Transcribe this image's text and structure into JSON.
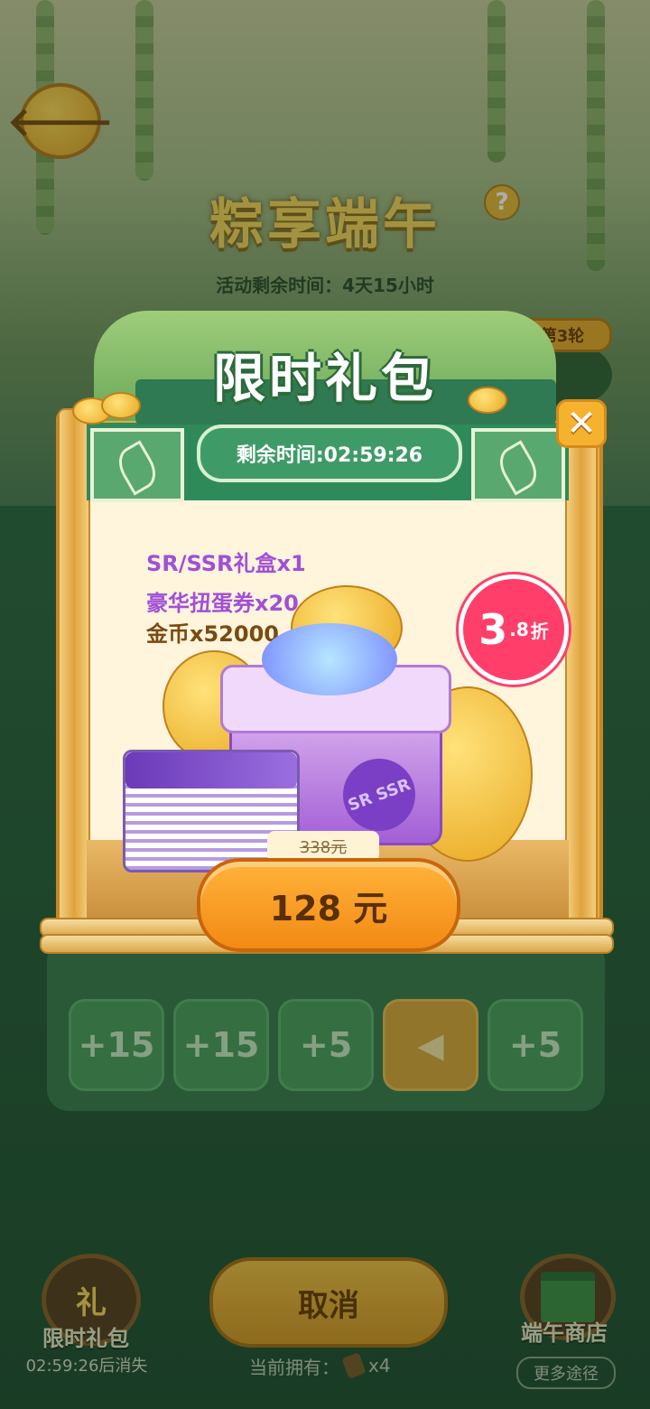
{
  "event": {
    "title": "粽享端午",
    "help_glyph": "?",
    "remaining": "活动剩余时间：4天15小时",
    "round": "第3轮",
    "back_glyph": "🡐"
  },
  "grid": {
    "tiles": [
      "+15",
      "+15",
      "+5",
      "◀",
      "+5"
    ]
  },
  "popup": {
    "title": "限时礼包",
    "close_glyph": "✕",
    "timer": "剩余时间:02:59:26",
    "items": [
      "SR/SSR礼盒x1",
      "豪华扭蛋券x20",
      "金币x52000"
    ],
    "discount_big": "3",
    "discount_small": ".8",
    "discount_unit": "折",
    "gift_logo": "SR SSR",
    "old_price": "338元",
    "buy_label": "128 元"
  },
  "bottom": {
    "left_label": "限时礼包",
    "left_icon": "礼",
    "left_timer": "02:59:26后消失",
    "cancel_label": "取消",
    "owned_label": "当前拥有：",
    "owned_count": "x4",
    "shop_label": "端午商店",
    "more_label": "更多途径"
  },
  "colors": {
    "accent_orange": "#f28a14",
    "popup_green": "#2f8a5a",
    "discount_red": "#ff3f6a",
    "item_purple": "#a24fd6"
  }
}
